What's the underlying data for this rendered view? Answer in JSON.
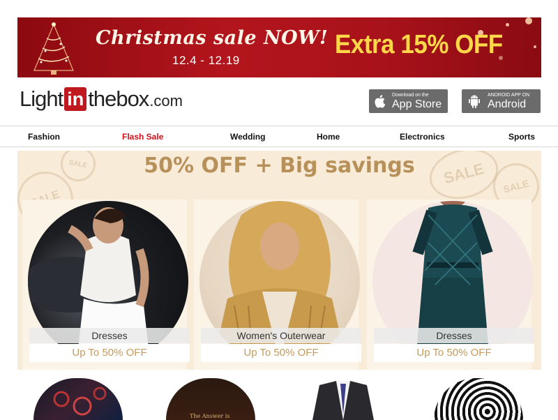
{
  "banner": {
    "title": "Christmas sale NOW!",
    "dates": "12.4 - 12.19",
    "extra": "Extra 15% OFF"
  },
  "header": {
    "logo": {
      "part1": "Light",
      "part2": "in",
      "part3": "thebox",
      "suffix": ".com"
    },
    "app_store": {
      "small": "Download on the",
      "big": "App Store",
      "icon": "apple-icon"
    },
    "android": {
      "small": "ANDROID APP ON",
      "big": "Android",
      "icon": "android-icon"
    }
  },
  "nav": {
    "items": [
      {
        "label": "Fashion",
        "hot": false
      },
      {
        "label": "Flash Sale",
        "hot": true
      },
      {
        "label": "Wedding",
        "hot": false
      },
      {
        "label": "Home",
        "hot": false
      },
      {
        "label": "Electronics",
        "hot": false
      },
      {
        "label": "Sports",
        "hot": false
      }
    ]
  },
  "promo": {
    "title": "50% OFF + Big savings",
    "stamp_text": "SALE",
    "cards": [
      {
        "category": "Dresses",
        "offer": "Up To 50% OFF"
      },
      {
        "category": "Women's Outerwear",
        "offer": "Up To 50% OFF"
      },
      {
        "category": "Dresses",
        "offer": "Up To 50% OFF"
      }
    ]
  },
  "bottom_products": {
    "shirt_text": "The Answer is"
  },
  "colors": {
    "brand_red": "#c0181f",
    "hot_nav": "#d0111b",
    "promo_gold": "#b8915a",
    "offer_gold": "#c49a5c",
    "banner_yellow": "#ffd84a"
  }
}
